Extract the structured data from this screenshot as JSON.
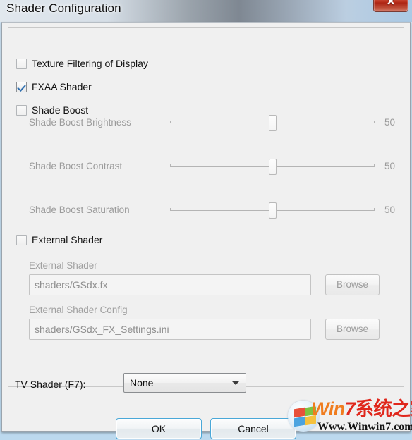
{
  "window": {
    "title": "Shader Configuration",
    "close_label": "✕"
  },
  "checkboxes": [
    {
      "label": "Texture Filtering of Display",
      "checked": false,
      "enabled": true
    },
    {
      "label": "FXAA Shader",
      "checked": true,
      "enabled": true
    },
    {
      "label": "Shade Boost",
      "checked": false,
      "enabled": true
    }
  ],
  "sliders": [
    {
      "label": "Shade Boost Brightness",
      "value": "50",
      "min": 0,
      "max": 100,
      "enabled": false
    },
    {
      "label": "Shade Boost Contrast",
      "value": "50",
      "min": 0,
      "max": 100,
      "enabled": false
    },
    {
      "label": "Shade Boost Saturation",
      "value": "50",
      "min": 0,
      "max": 100,
      "enabled": false
    }
  ],
  "external_shader": {
    "checkbox_label": "External Shader",
    "checked": false,
    "shader_field_label": "External Shader",
    "shader_field_value": "shaders/GSdx.fx",
    "shader_browse_label": "Browse",
    "config_field_label": "External Shader Config",
    "config_field_value": "shaders/GSdx_FX_Settings.ini",
    "config_browse_label": "Browse"
  },
  "tv_shader": {
    "label": "TV Shader (F7):",
    "selected": "None"
  },
  "buttons": {
    "ok": "OK",
    "cancel": "Cancel"
  },
  "watermark": {
    "brand_win": "Win",
    "brand_seven": "7",
    "brand_cn": "系统之家",
    "url": "Www.Winwin7.com"
  },
  "colors": {
    "accent_blue": "#2f6fb0",
    "close_red": "#b9301c",
    "button_border_blue": "#4aa8d8",
    "disabled_text": "#9b9b9b",
    "dialog_bg": "#f0f0f0"
  }
}
